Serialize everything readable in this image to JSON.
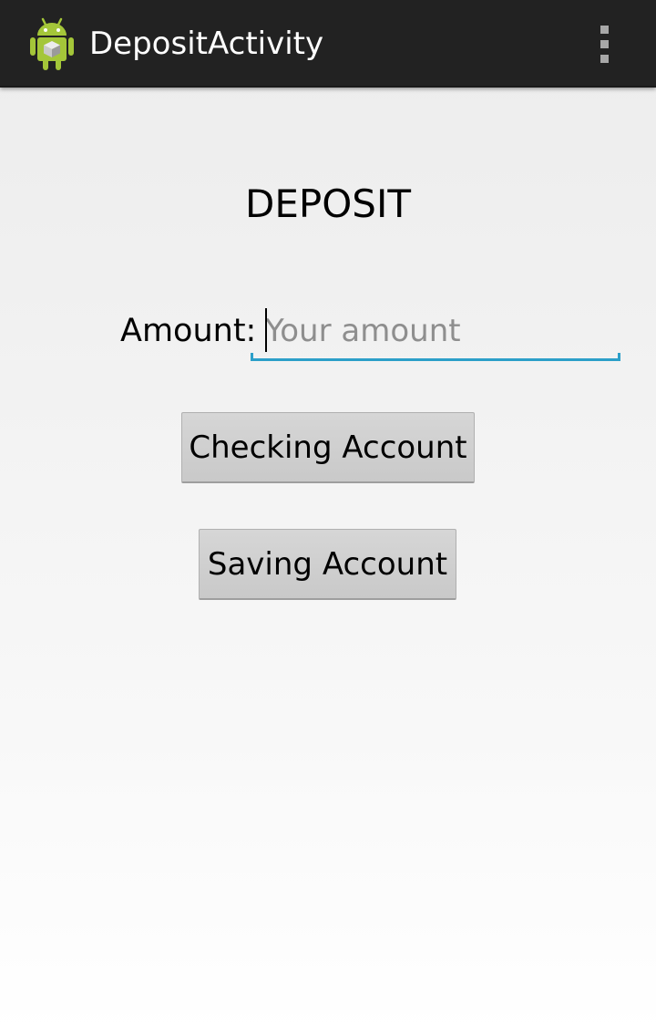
{
  "action_bar": {
    "title": "DepositActivity",
    "app_icon": "android-robot-icon",
    "overflow_icon": "overflow-menu-icon",
    "background_color": "#222222"
  },
  "main": {
    "heading": "DEPOSIT",
    "amount_label": "Amount:",
    "amount_input": {
      "value": "",
      "placeholder": "Your amount"
    },
    "buttons": {
      "checking_label": "Checking Account",
      "saving_label": "Saving Account"
    },
    "accent_color": "#2c9fc9"
  }
}
